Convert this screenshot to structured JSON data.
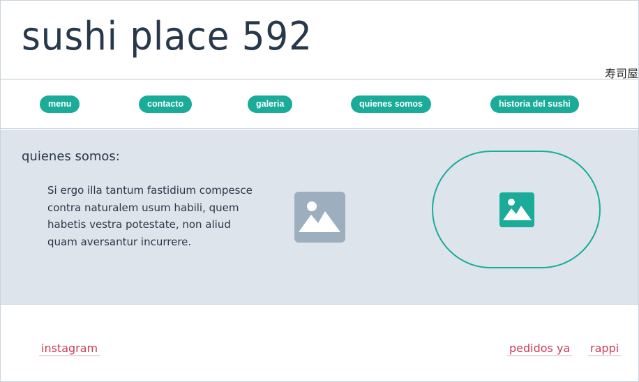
{
  "header": {
    "title": "sushi place 592",
    "tagline": "寿司屋"
  },
  "nav": {
    "items": [
      {
        "label": "menu"
      },
      {
        "label": "contacto"
      },
      {
        "label": "galeria"
      },
      {
        "label": "quienes somos"
      },
      {
        "label": "historia del sushi"
      }
    ]
  },
  "main": {
    "heading": "quienes somos:",
    "paragraph": "Si ergo illa tantum fastidium compesce contra naturalem usum habili, quem habetis vestra potestate, non aliud quam aversantur incurrere.",
    "images": [
      {
        "icon": "image-placeholder-icon",
        "color": "#9dafbf"
      },
      {
        "icon": "image-placeholder-icon",
        "color": "#1aab99"
      }
    ]
  },
  "footer": {
    "links": [
      {
        "label": "instagram"
      },
      {
        "label": "pedidos ya"
      },
      {
        "label": "rappi"
      }
    ]
  },
  "colors": {
    "accent": "#1aab99",
    "title": "#27384a",
    "main_bg": "#dee4ec",
    "link": "#cc3b55"
  }
}
